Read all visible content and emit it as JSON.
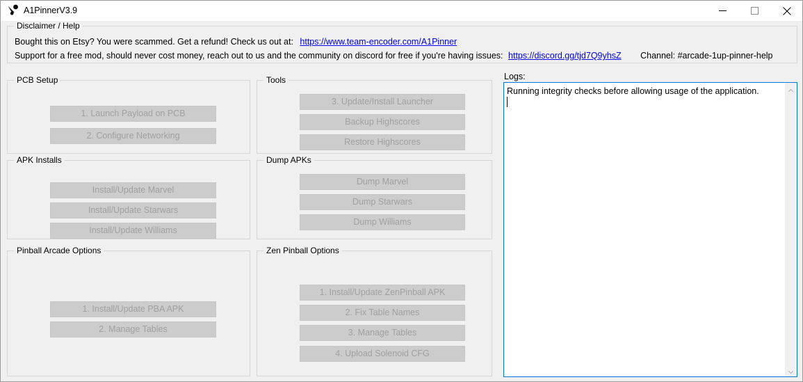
{
  "window": {
    "title": "A1PinnerV3.9",
    "icon": "pinball-icon",
    "controls": {
      "minimize": "minimize-icon",
      "maximize": "maximize-icon",
      "close": "close-icon"
    }
  },
  "disclaimer": {
    "legend": "Disclaimer / Help",
    "line1_prefix": "Bought this on Etsy? You were scammed. Get a refund! Check us out at:",
    "line1_link": "https://www.team-encoder.com/A1Pinner",
    "line2_prefix": "Support for a free mod, should never cost money, reach out to us and the community on discord for free if you're having issues:",
    "line2_link": "https://discord.gg/tjd7Q9yhsZ",
    "line2_channel": "Channel: #arcade-1up-pinner-help"
  },
  "groups": {
    "pcb_setup": {
      "legend": "PCB Setup",
      "buttons": [
        "1. Launch Payload on PCB",
        "2. Configure Networking"
      ]
    },
    "apk_installs": {
      "legend": "APK Installs",
      "buttons": [
        "Install/Update Marvel",
        "Install/Update Starwars",
        "Install/Update Williams"
      ]
    },
    "pinball_arcade_options": {
      "legend": "Pinball Arcade Options",
      "buttons": [
        "1. Install/Update PBA APK",
        "2. Manage Tables"
      ]
    },
    "tools": {
      "legend": "Tools",
      "buttons": [
        "3. Update/Install Launcher",
        "Backup Highscores",
        "Restore Highscores"
      ]
    },
    "dump_apks": {
      "legend": "Dump APKs",
      "buttons": [
        "Dump Marvel",
        "Dump Starwars",
        "Dump Williams"
      ]
    },
    "zen_pinball_options": {
      "legend": "Zen Pinball Options",
      "buttons": [
        "1. Install/Update ZenPinball APK",
        "2. Fix Table Names",
        "3. Manage Tables",
        "4. Upload Solenoid CFG"
      ]
    }
  },
  "logs": {
    "label": "Logs:",
    "text": "Running integrity checks before allowing usage of the application.",
    "scrollbar": {
      "up": "scroll-up-icon",
      "down": "scroll-down-icon"
    }
  },
  "colors": {
    "window_bg": "#f0f0f0",
    "button_face": "#cccccc",
    "button_disabled_text": "#a0a0a0",
    "link": "#0000ee",
    "focus_border": "#0078d7",
    "group_border": "#d5d5d5"
  }
}
